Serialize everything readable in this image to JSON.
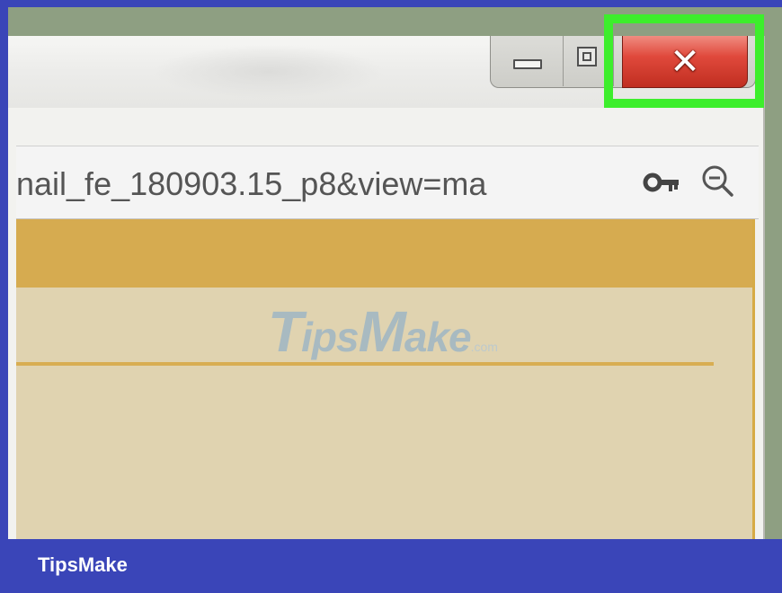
{
  "window": {
    "url": "nail_fe_180903.15_p8&view=ma",
    "controls": {
      "minimize_icon": "minimize-icon",
      "maximize_icon": "maximize-icon",
      "close_icon": "close-icon",
      "close_glyph": "✕"
    },
    "toolbar_icons": [
      "key-icon",
      "zoom-out-icon"
    ]
  },
  "watermark": {
    "big1": "T",
    "small1": "ips",
    "big2": "M",
    "small2": "ake",
    "suffix": ".com"
  },
  "footer": {
    "brand": "TipsMake"
  },
  "colors": {
    "frame": "#3a45b8",
    "highlight": "#3dee2c",
    "close_button": "#d83a2c",
    "gold": "#d6ab50",
    "content_bg": "#e0d3b0"
  }
}
